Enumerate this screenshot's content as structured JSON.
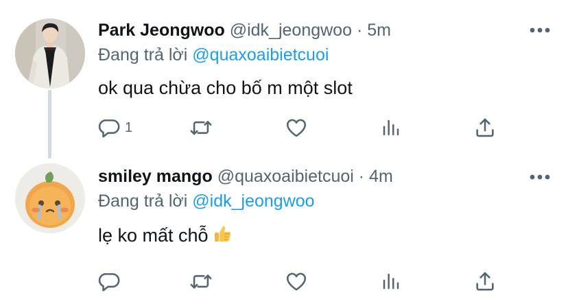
{
  "tweets": [
    {
      "name": "Park Jeongwoo",
      "handle": "@idk_jeongwoo",
      "separator": "·",
      "time": "5m",
      "replying_prefix": "Đang trả lời",
      "replying_to": "@quaxoaibietcuoi",
      "text": "ok qua chừa cho bố m một slot",
      "reply_count": "1",
      "avatar_icon": "person-photo-avatar"
    },
    {
      "name": "smiley mango",
      "handle": "@quaxoaibietcuoi",
      "separator": "·",
      "time": "4m",
      "replying_prefix": "Đang trả lời",
      "replying_to": "@idk_jeongwoo",
      "text": "lẹ ko mất chỗ",
      "emoji_icon": "thumbs-up-icon",
      "reply_count": "",
      "avatar_icon": "mango-avatar"
    }
  ],
  "icons": {
    "more": "more-horizontal-icon",
    "reply": "reply-icon",
    "retweet": "retweet-icon",
    "like": "heart-icon",
    "analytics": "analytics-icon",
    "share": "share-icon"
  },
  "colors": {
    "text_primary": "#0f1419",
    "text_secondary": "#536471",
    "mention": "#1d9bf0",
    "thread_line": "#cfd9de"
  }
}
